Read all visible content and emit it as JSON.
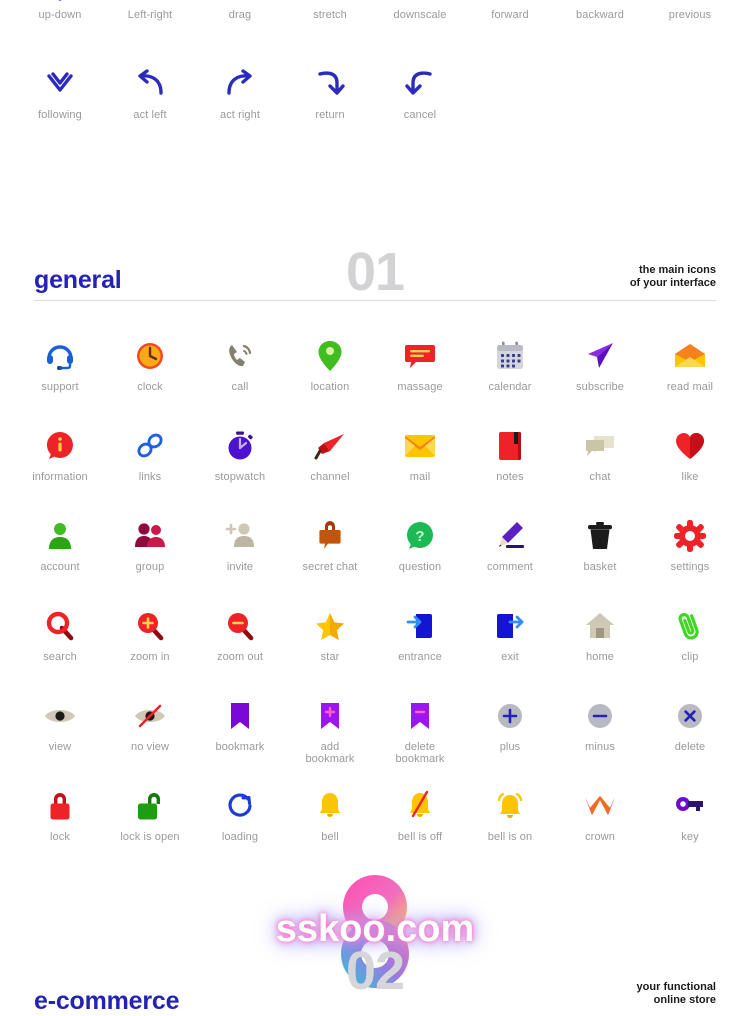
{
  "arrows_top": [
    {
      "label": "up-down",
      "icon": "arrow-up-down-icon"
    },
    {
      "label": "Left-right",
      "icon": "arrow-left-right-icon"
    },
    {
      "label": "drag",
      "icon": "drag-icon"
    },
    {
      "label": "stretch",
      "icon": "stretch-icon"
    },
    {
      "label": "downscale",
      "icon": "downscale-icon"
    },
    {
      "label": "forward",
      "icon": "forward-icon"
    },
    {
      "label": "backward",
      "icon": "backward-icon"
    },
    {
      "label": "previous",
      "icon": "previous-icon"
    }
  ],
  "arrows_second": [
    {
      "label": "following",
      "icon": "chevron-double-down-icon"
    },
    {
      "label": "act left",
      "icon": "arrow-curve-left-icon"
    },
    {
      "label": "act right",
      "icon": "arrow-curve-right-icon"
    },
    {
      "label": "return",
      "icon": "arrow-return-icon"
    },
    {
      "label": "cancel",
      "icon": "arrow-cancel-icon"
    }
  ],
  "general_section": {
    "title": "general",
    "number": "01",
    "subtitle_line1": "the main icons",
    "subtitle_line2": "of your interface",
    "accent_color": "#2323b5",
    "number_color": "#d3d3d6",
    "rule_color": "#dcdce0",
    "label_color": "#9a9a9a",
    "icons": [
      {
        "label": "support",
        "icon": "headset-icon"
      },
      {
        "label": "clock",
        "icon": "clock-icon"
      },
      {
        "label": "call",
        "icon": "phone-icon"
      },
      {
        "label": "location",
        "icon": "map-pin-icon"
      },
      {
        "label": "massage",
        "icon": "speech-bubble-icon"
      },
      {
        "label": "calendar",
        "icon": "calendar-icon"
      },
      {
        "label": "subscribe",
        "icon": "paper-plane-icon"
      },
      {
        "label": "read mail",
        "icon": "open-envelope-icon"
      },
      {
        "label": "information",
        "icon": "info-bubble-icon"
      },
      {
        "label": "links",
        "icon": "chain-link-icon"
      },
      {
        "label": "stopwatch",
        "icon": "stopwatch-icon"
      },
      {
        "label": "channel",
        "icon": "megaphone-icon"
      },
      {
        "label": "mail",
        "icon": "envelope-icon"
      },
      {
        "label": "notes",
        "icon": "notebook-icon"
      },
      {
        "label": "chat",
        "icon": "chat-bubbles-icon"
      },
      {
        "label": "like",
        "icon": "heart-icon"
      },
      {
        "label": "account",
        "icon": "user-icon"
      },
      {
        "label": "group",
        "icon": "users-icon"
      },
      {
        "label": "invite",
        "icon": "user-add-icon"
      },
      {
        "label": "secret chat",
        "icon": "lock-bubble-icon"
      },
      {
        "label": "question",
        "icon": "question-bubble-icon"
      },
      {
        "label": "comment",
        "icon": "pencil-icon"
      },
      {
        "label": "basket",
        "icon": "trash-icon"
      },
      {
        "label": "settings",
        "icon": "gear-icon"
      },
      {
        "label": "search",
        "icon": "magnifier-icon"
      },
      {
        "label": "zoom in",
        "icon": "magnifier-plus-icon"
      },
      {
        "label": "zoom out",
        "icon": "magnifier-minus-icon"
      },
      {
        "label": "star",
        "icon": "star-icon"
      },
      {
        "label": "entrance",
        "icon": "login-icon"
      },
      {
        "label": "exit",
        "icon": "logout-icon"
      },
      {
        "label": "home",
        "icon": "house-icon"
      },
      {
        "label": "clip",
        "icon": "paperclip-icon"
      },
      {
        "label": "view",
        "icon": "eye-icon"
      },
      {
        "label": "no view",
        "icon": "eye-off-icon"
      },
      {
        "label": "bookmark",
        "icon": "bookmark-icon"
      },
      {
        "label": "add\nbookmark",
        "icon": "bookmark-add-icon"
      },
      {
        "label": "delete\nbookmark",
        "icon": "bookmark-remove-icon"
      },
      {
        "label": "plus",
        "icon": "plus-circle-icon"
      },
      {
        "label": "minus",
        "icon": "minus-circle-icon"
      },
      {
        "label": "delete",
        "icon": "close-circle-icon"
      },
      {
        "label": "lock",
        "icon": "padlock-closed-icon"
      },
      {
        "label": "lock is open",
        "icon": "padlock-open-icon"
      },
      {
        "label": "loading",
        "icon": "spinner-icon"
      },
      {
        "label": "bell",
        "icon": "bell-icon"
      },
      {
        "label": "bell is off",
        "icon": "bell-off-icon"
      },
      {
        "label": "bell is on",
        "icon": "bell-ringing-icon"
      },
      {
        "label": "crown",
        "icon": "crown-icon"
      },
      {
        "label": "key",
        "icon": "key-icon"
      }
    ]
  },
  "watermark": {
    "text": "sskoo.com",
    "logo": "number-eight-logo"
  },
  "ecommerce_section": {
    "title": "e-commerce",
    "number": "02",
    "subtitle_line1": "your functional",
    "subtitle_line2": "online store"
  }
}
